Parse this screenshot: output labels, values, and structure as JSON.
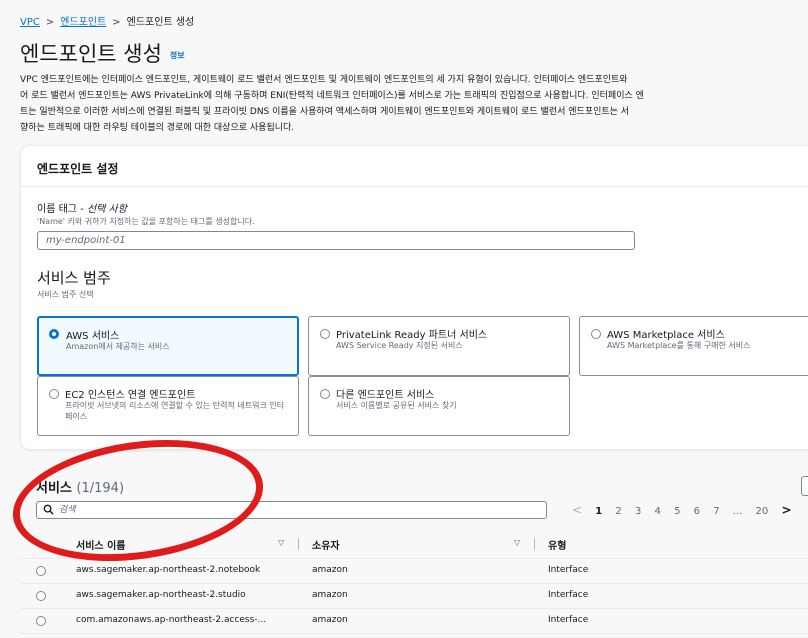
{
  "breadcrumb": {
    "items": [
      "VPC",
      "엔드포인트",
      "엔드포인트 생성"
    ],
    "separator": ">"
  },
  "page": {
    "title": "엔드포인트 생성",
    "info_link": "정보",
    "description_lines": [
      "VPC 엔드포인트에는 인터페이스 엔드포인트, 게이트웨이 로드 밸런서 엔드포인트 및 게이트웨이 엔드포인트의 세 가지 유형이 있습니다. 인터페이스 엔드포인트와",
      "어 로드 밸런서 엔드포인트는 AWS PrivateLink에 의해 구동하며 ENI(탄력적 네트워크 인터페이스)를 서비스로 가는 트래픽의 진입점으로 사용합니다. 인터페이스 엔",
      "트는 일반적으로 이러한 서비스에 연결된 퍼블릭 및 프라이빗 DNS 이름을 사용하여 액세스하며 게이트웨이 엔드포인트와 게이트웨이 로드 밸런서 엔드포인트는 서",
      "향하는 트래픽에 대한 라우팅 테이블의 경로에 대한 대상으로 사용됩니다."
    ]
  },
  "endpoint_settings": {
    "title": "엔드포인트 설정",
    "name_tag_label": "이름 태그 - ",
    "name_tag_optional": "선택 사항",
    "name_tag_desc": "'Name' 키와 귀하가 지정하는 값을 포함하는 태그를 생성합니다.",
    "name_tag_placeholder": "my-endpoint-01",
    "service_category_title": "서비스 범주",
    "service_category_desc": "서비스 범주 선택",
    "tiles": [
      {
        "title": "AWS 서비스",
        "desc": "Amazon에서 제공하는 서비스",
        "selected": true
      },
      {
        "title": "PrivateLink Ready 파트너 서비스",
        "desc": "AWS Service Ready 지정된 서비스",
        "selected": false
      },
      {
        "title": "AWS Marketplace 서비스",
        "desc": "AWS Marketplace를 통해 구매한 서비스",
        "selected": false
      },
      {
        "title": "EC2 인스턴스 연결 엔드포인트",
        "desc": "프라이빗 서브넷의 리소스에 연결할 수 있는 탄력적 네트워크 인터페이스",
        "selected": false
      },
      {
        "title": "다른 엔드포인트 서비스",
        "desc": "서비스 이름별로 공유된 서비스 찾기",
        "selected": false
      }
    ]
  },
  "services": {
    "title": "서비스",
    "count": "(1/194)",
    "search_placeholder": "검색",
    "pagination": {
      "prev": "<",
      "pages": [
        "1",
        "2",
        "3",
        "4",
        "5",
        "6",
        "7"
      ],
      "ellipsis": "...",
      "last": "20",
      "next": ">",
      "current": "1"
    },
    "columns": [
      "서비스 이름",
      "소유자",
      "유형"
    ],
    "rows": [
      {
        "name": "aws.sagemaker.ap-northeast-2.notebook",
        "owner": "amazon",
        "type": "Interface"
      },
      {
        "name": "aws.sagemaker.ap-northeast-2.studio",
        "owner": "amazon",
        "type": "Interface"
      },
      {
        "name": "com.amazonaws.ap-northeast-2.access-...",
        "owner": "amazon",
        "type": "Interface"
      }
    ]
  },
  "colors": {
    "link": "#0972d3",
    "annotation": "#e01b1b",
    "selected_tile_bg": "#f1faff"
  }
}
